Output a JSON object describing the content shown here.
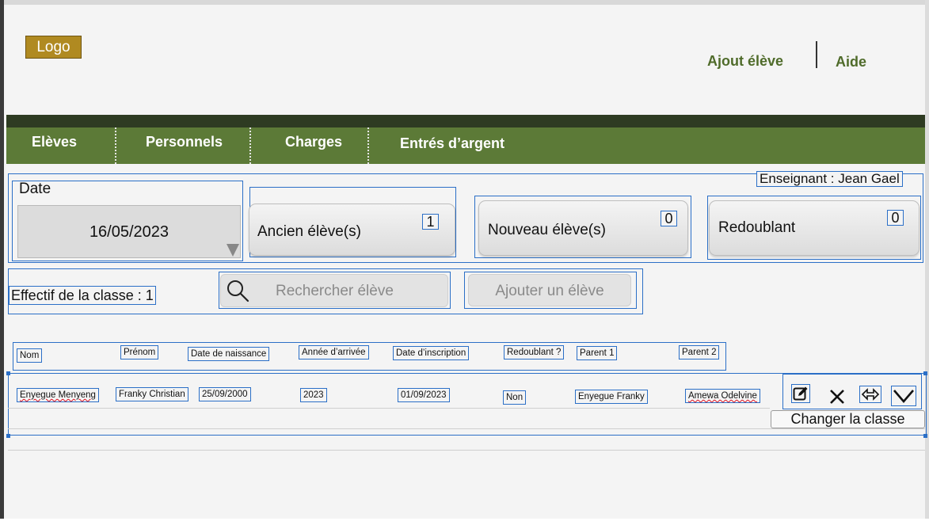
{
  "header": {
    "logo_text": "Logo",
    "links": {
      "ajout": "Ajout élève",
      "aide": "Aide"
    }
  },
  "nav": {
    "items": [
      "Elèves",
      "Personnels",
      "Charges",
      "Entrés d’argent"
    ]
  },
  "teacher_label": "Enseignant : Jean Gael",
  "date": {
    "label": "Date",
    "value": "16/05/2023"
  },
  "stats": [
    {
      "label": "Ancien élève(s)",
      "count": "1"
    },
    {
      "label": "Nouveau élève(s)",
      "count": "0"
    },
    {
      "label": "Redoublant",
      "count": "0"
    }
  ],
  "effectif_label": "Effectif de la classe : 1",
  "search": {
    "placeholder": "Rechercher élève",
    "icon": "search-icon"
  },
  "add_button": "Ajouter un élève",
  "table": {
    "columns": [
      "Nom",
      "Prénom",
      "Date de naissance",
      "Année d’arrivée",
      "Date d’inscription",
      "Redoublant ?",
      "Parent 1",
      "Parent 2"
    ],
    "rows": [
      [
        "Enyegue Menyeng",
        "Franky Christian",
        "25/09/2000",
        "2023",
        "01/09/2023",
        "Non",
        "Enyegue Franky",
        "Amewa Odelvine"
      ]
    ]
  },
  "row_actions": {
    "icons": [
      "edit-icon",
      "delete-icon",
      "swap-icon",
      "expand-icon"
    ],
    "change_class": "Changer la classe"
  },
  "colors": {
    "logo_bg": "#b08a21",
    "nav_bg": "#5c7a37",
    "nav_dark": "#2e3b22",
    "link": "#4f6b2a",
    "selection_blue": "#2b6fc7"
  }
}
